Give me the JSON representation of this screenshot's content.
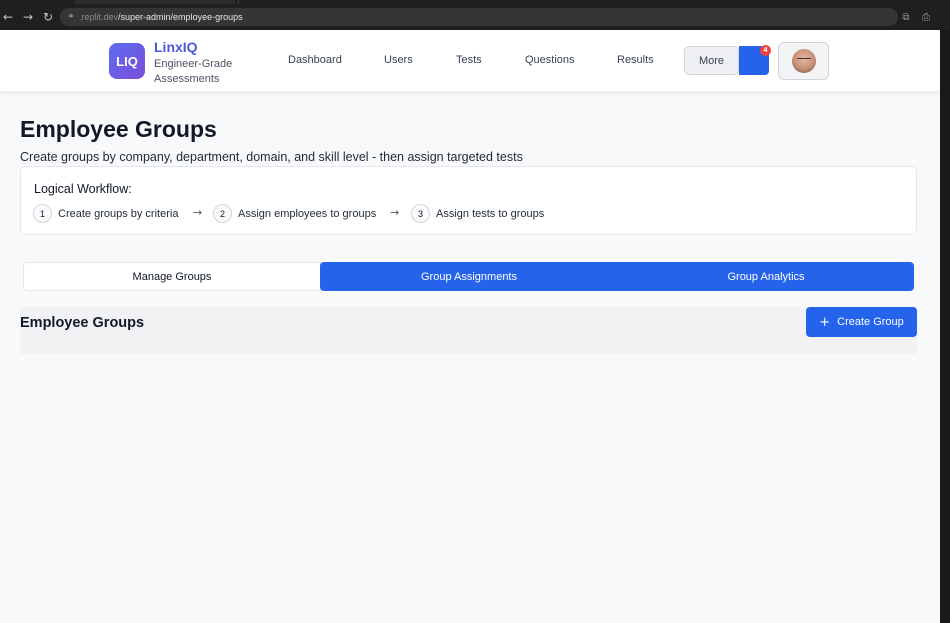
{
  "browser": {
    "url_host": ".replit.dev",
    "url_path": "/super-admin/employee-groups",
    "back_icon": "arrow-left-icon",
    "forward_icon": "arrow-right-icon",
    "reload_icon": "reload-icon"
  },
  "header": {
    "logo_text": "LIQ",
    "brand_name": "LinxIQ",
    "brand_tagline": "Engineer-Grade Assessments",
    "nav": [
      "Dashboard",
      "Users",
      "Tests",
      "Questions",
      "Results"
    ],
    "more_label": "More",
    "notification_count": "4",
    "accent_color": "#2563eb"
  },
  "page": {
    "title": "Employee Groups",
    "subtitle": "Create groups by company, department, domain, and skill level - then assign targeted tests"
  },
  "workflow": {
    "title": "Logical Workflow:",
    "steps": [
      {
        "num": "1",
        "label": "Create groups by criteria"
      },
      {
        "num": "2",
        "label": "Assign employees to groups"
      },
      {
        "num": "3",
        "label": "Assign tests to groups"
      }
    ],
    "arrow": "→"
  },
  "tabs": [
    "Manage Groups",
    "Group Assignments",
    "Group Analytics"
  ],
  "section": {
    "title": "Employee Groups",
    "create_button": "Create Group",
    "create_icon": "plus-icon"
  }
}
